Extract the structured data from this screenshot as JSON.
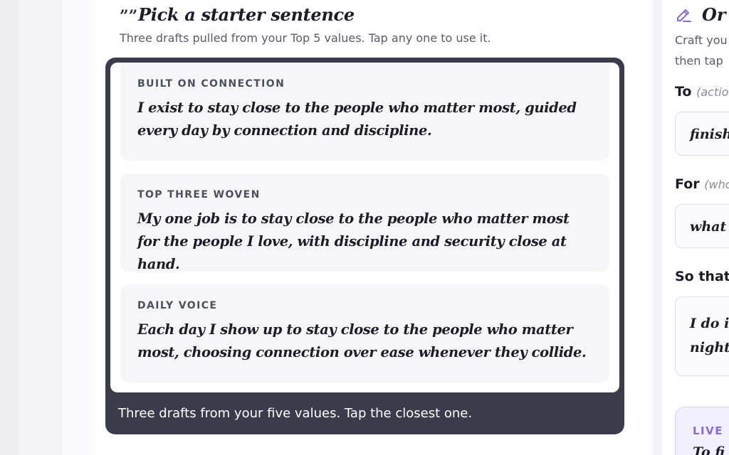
{
  "starter_section": {
    "title": "Pick a starter sentence",
    "subtitle": "Three drafts pulled from your Top 5 values. Tap any one to use it.",
    "quote_icon": "””",
    "drafts": [
      {
        "label": "BUILT ON CONNECTION",
        "text": "I exist to stay close to the people who matter most, guided every day by connection and discipline."
      },
      {
        "label": "TOP THREE WOVEN",
        "text": "My one job is to stay close to the people who matter most for the people I love, with discipline and security close at hand."
      },
      {
        "label": "DAILY VOICE",
        "text": "Each day I show up to stay close to the people who matter most, choosing connection over ease whenever they collide."
      }
    ],
    "caption": "Three drafts from your five values. Tap the closest one."
  },
  "custom_section": {
    "title": "Or",
    "subtitle_line1": "Craft you",
    "subtitle_line2": "then tap",
    "to_label": "To",
    "to_hint": "(actio",
    "to_value": "finish",
    "for_label": "For",
    "for_hint": "(who",
    "for_value": "what",
    "so_that_label": "So that",
    "so_that_line1": "I do it",
    "so_that_line2": "night",
    "live_label": "LIVE P",
    "live_preview": "To fi"
  },
  "colors": {
    "frame": "#3a3c4b",
    "accent_purple": "#8b6ad8",
    "live_bg": "#f3f0fd"
  }
}
